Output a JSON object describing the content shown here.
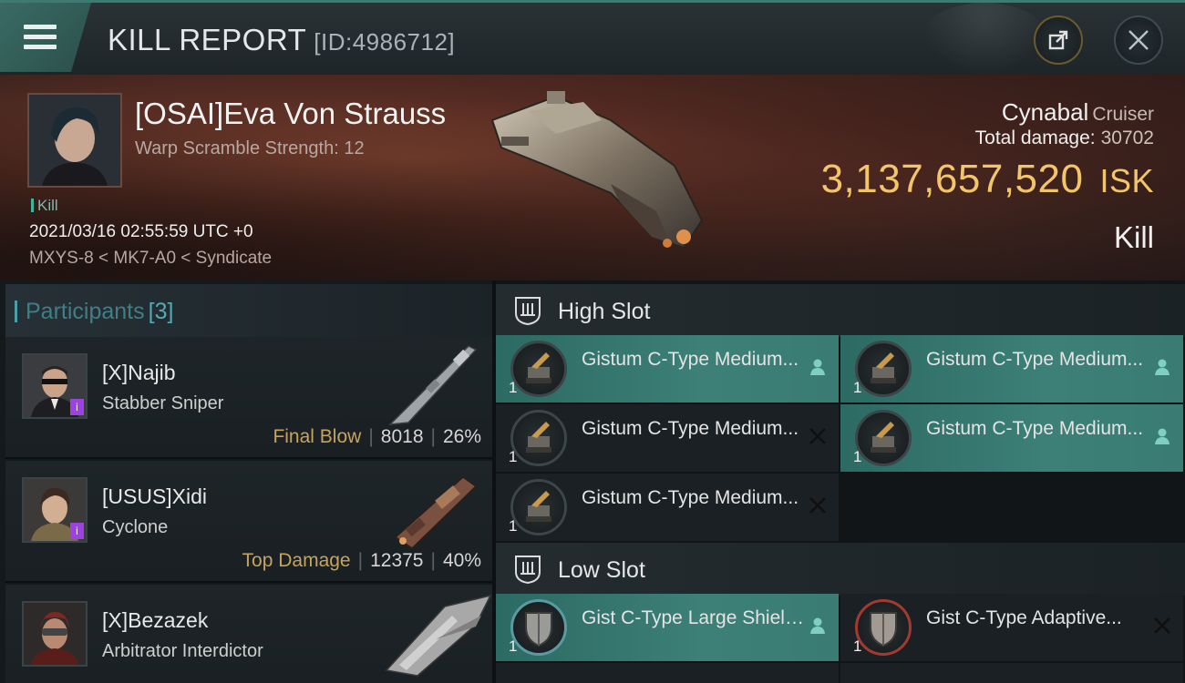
{
  "header": {
    "title": "KILL REPORT",
    "id_label": "[ID:4986712]"
  },
  "victim": {
    "name": "[OSAI]Eva Von Strauss",
    "subtitle": "Warp Scramble Strength: 12",
    "kill_tag": "Kill",
    "timestamp": "2021/03/16 02:55:59 UTC +0",
    "location": "MXYS-8 < MK7-A0 < Syndicate",
    "ship": "Cynabal",
    "ship_class": "Cruiser",
    "total_damage_label": "Total damage:",
    "total_damage": "30702",
    "isk_value": "3,137,657,520",
    "isk_unit": "ISK",
    "result": "Kill"
  },
  "participants": {
    "label": "Participants",
    "count": "[3]",
    "items": [
      {
        "name": "[X]Najib",
        "ship": "Stabber Sniper",
        "tag": "Final Blow",
        "damage": "8018",
        "percent": "26%"
      },
      {
        "name": "[USUS]Xidi",
        "ship": "Cyclone",
        "tag": "Top Damage",
        "damage": "12375",
        "percent": "40%"
      },
      {
        "name": "[X]Bezazek",
        "ship": "Arbitrator Interdictor"
      }
    ]
  },
  "high_slot": {
    "label": "High Slot",
    "modules": [
      {
        "name": "Gistum C-Type Medium...",
        "qty": "1",
        "state": "user-icon"
      },
      {
        "name": "Gistum C-Type Medium...",
        "qty": "1",
        "state": "user-icon"
      },
      {
        "name": "Gistum C-Type Medium...",
        "qty": "1",
        "state": "destroyed-icon"
      },
      {
        "name": "Gistum C-Type Medium...",
        "qty": "1",
        "state": "user-icon"
      },
      {
        "name": "Gistum C-Type Medium...",
        "qty": "1",
        "state": "destroyed-icon"
      }
    ]
  },
  "low_slot": {
    "label": "Low Slot",
    "modules": [
      {
        "name": "Gist C-Type Large Shield...",
        "qty": "1",
        "state": "user-icon"
      },
      {
        "name": "Gist C-Type Adaptive...",
        "qty": "1",
        "state": "destroyed-icon"
      }
    ]
  },
  "colors": {
    "accent_teal": "#3c8078",
    "isk_gold": "#f3c56b",
    "tag_gold": "#c6a45e",
    "hero_red": "#8b4a35"
  }
}
